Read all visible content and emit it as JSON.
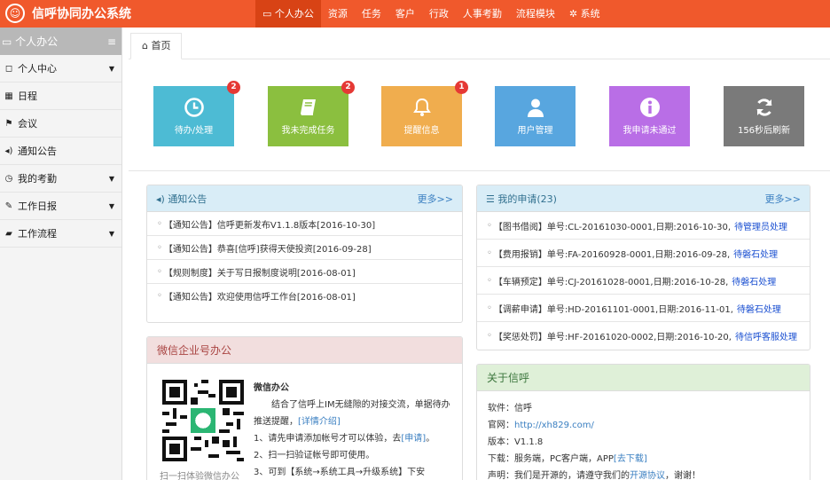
{
  "app": {
    "title": "信呼协同办公系统",
    "logo_glyph": "☺"
  },
  "topnav": [
    {
      "label": "个人办公",
      "icon": "monitor-icon",
      "active": true
    },
    {
      "label": "资源"
    },
    {
      "label": "任务"
    },
    {
      "label": "客户"
    },
    {
      "label": "行政"
    },
    {
      "label": "人事考勤"
    },
    {
      "label": "流程模块"
    },
    {
      "label": "系统",
      "icon": "gear-icon"
    }
  ],
  "sidebar": {
    "header": "个人办公",
    "items": [
      {
        "label": "个人中心",
        "icon": "bookmark-icon",
        "arrow": true
      },
      {
        "label": "日程",
        "icon": "calendar-icon",
        "arrow": false
      },
      {
        "label": "会议",
        "icon": "flag-icon",
        "arrow": false
      },
      {
        "label": "通知公告",
        "icon": "speaker-icon",
        "arrow": false
      },
      {
        "label": "我的考勤",
        "icon": "clock-icon",
        "arrow": true
      },
      {
        "label": "工作日报",
        "icon": "edit-icon",
        "arrow": true
      },
      {
        "label": "工作流程",
        "icon": "book-icon",
        "arrow": true
      }
    ]
  },
  "tab": {
    "label": "首页",
    "icon": "home-icon"
  },
  "tiles": [
    {
      "label": "待办/处理",
      "badge": "2",
      "color": "#4dbbd4",
      "icon": "clock-icon"
    },
    {
      "label": "我未完成任务",
      "badge": "2",
      "color": "#8bbf3f",
      "icon": "book-icon"
    },
    {
      "label": "提醒信息",
      "badge": "1",
      "color": "#f0ad4e",
      "icon": "bell-icon"
    },
    {
      "label": "用户管理",
      "badge": "",
      "color": "#58a6df",
      "icon": "user-icon"
    },
    {
      "label": "我申请未通过",
      "badge": "",
      "color": "#b96ee6",
      "icon": "info-icon"
    },
    {
      "label": "156秒后刷新",
      "badge": "",
      "color": "#7a7a7a",
      "icon": "refresh-icon"
    }
  ],
  "notice": {
    "title": "通知公告",
    "more": "更多>>",
    "items": [
      "【通知公告】信呼更新发布V1.1.8版本[2016-10-30]",
      "【通知公告】恭喜[信呼]获得天使投资[2016-09-28]",
      "【规则制度】关于写日报制度说明[2016-08-01]",
      "【通知公告】欢迎使用信呼工作台[2016-08-01]"
    ]
  },
  "apply": {
    "title": "我的申请(23)",
    "more": "更多>>",
    "items": [
      {
        "text": "【图书借阅】单号:CL-20161030-0001,日期:2016-10-30,",
        "status": "待管理员处理"
      },
      {
        "text": "【费用报销】单号:FA-20160928-0001,日期:2016-09-28,",
        "status": "待磐石处理"
      },
      {
        "text": "【车辆预定】单号:CJ-20161028-0001,日期:2016-10-28,",
        "status": "待磐石处理"
      },
      {
        "text": "【调薪申请】单号:HD-20161101-0001,日期:2016-11-01,",
        "status": "待磐石处理"
      },
      {
        "text": "【奖惩处罚】单号:HF-20161020-0002,日期:2016-10-20,",
        "status": "待信呼客服处理"
      }
    ]
  },
  "wechat": {
    "title": "微信企业号办公",
    "subtitle": "微信办公",
    "desc": "结合了信呼上IM无缝隙的对接交流，单据待办推送提醒，",
    "detail_link": "[详情介绍]",
    "step1_a": "1、请先申请添加帐号才可以体验，去",
    "step1_link": "[申请]",
    "step1_b": "。",
    "step2": "2、扫一扫验证帐号即可使用。",
    "step3": "3、可到【系统→系统工具→升级系统】下安",
    "qr_caption": "扫一扫体验微信办公"
  },
  "about": {
    "title": "关于信呼",
    "software_label": "软件：",
    "software": "信呼",
    "site_label": "官网：",
    "site": "http://xh829.com/",
    "version_label": "版本：",
    "version": "V1.1.8",
    "download_label": "下载：",
    "download": "服务端，PC客户端，APP",
    "download_link": "[去下载]",
    "statement_label": "声明：",
    "statement_a": "我们是开源的，请遵守我们的",
    "statement_link": "开源协议",
    "statement_b": "，谢谢！"
  }
}
